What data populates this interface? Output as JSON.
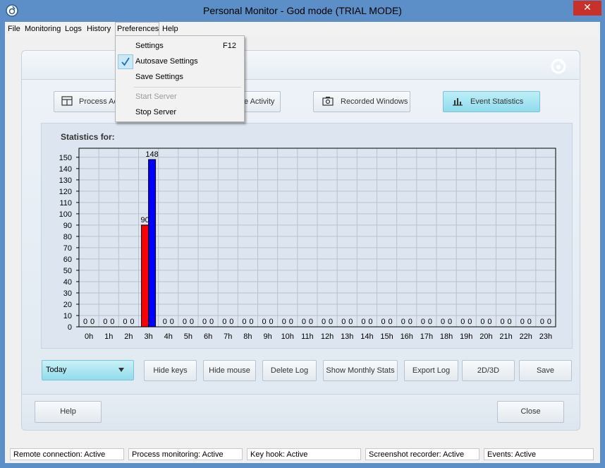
{
  "window": {
    "title": "Personal Monitor - God mode (TRIAL MODE)",
    "close_glyph": "✕"
  },
  "menu": [
    "File",
    "Monitoring",
    "Logs",
    "History",
    "Preferences",
    "Help"
  ],
  "preferences_menu": {
    "items": [
      {
        "label": "Settings",
        "shortcut": "F12",
        "checked": false,
        "disabled": false
      },
      {
        "label": "Autosave Settings",
        "shortcut": "",
        "checked": true,
        "disabled": false
      },
      {
        "label": "Save Settings",
        "shortcut": "",
        "checked": false,
        "disabled": false
      },
      {
        "label": "Start Server",
        "shortcut": "",
        "checked": false,
        "disabled": true
      },
      {
        "label": "Stop Server",
        "shortcut": "",
        "checked": false,
        "disabled": false
      }
    ]
  },
  "tabs": [
    {
      "label": "Process Ac",
      "icon": "window-icon"
    },
    {
      "label": "e Activity",
      "icon": ""
    },
    {
      "label": "Recorded Windows",
      "icon": "camera-icon"
    },
    {
      "label": "Event Statistics",
      "icon": "bar-chart-icon"
    }
  ],
  "stats_label": "Statistics for:",
  "chart_data": {
    "type": "bar",
    "categories": [
      "0h",
      "1h",
      "2h",
      "3h",
      "4h",
      "5h",
      "6h",
      "7h",
      "8h",
      "9h",
      "10h",
      "11h",
      "12h",
      "13h",
      "14h",
      "15h",
      "16h",
      "17h",
      "18h",
      "19h",
      "20h",
      "21h",
      "22h",
      "23h"
    ],
    "series": [
      {
        "values": [
          0,
          0,
          0,
          90,
          0,
          0,
          0,
          0,
          0,
          0,
          0,
          0,
          0,
          0,
          0,
          0,
          0,
          0,
          0,
          0,
          0,
          0,
          0,
          0
        ],
        "color": "#ff0000"
      },
      {
        "values": [
          0,
          0,
          0,
          148,
          0,
          0,
          0,
          0,
          0,
          0,
          0,
          0,
          0,
          0,
          0,
          0,
          0,
          0,
          0,
          0,
          0,
          0,
          0,
          0
        ],
        "color": "#0000ff"
      }
    ],
    "yticks": [
      0,
      10,
      20,
      30,
      40,
      50,
      60,
      70,
      80,
      90,
      100,
      110,
      120,
      130,
      140,
      150
    ],
    "ylim": [
      0,
      158
    ],
    "grid": true,
    "legend": "none"
  },
  "period_select": {
    "value": "Today"
  },
  "action_buttons": [
    "Hide keys",
    "Hide mouse",
    "Delete Log",
    "Show Monthly Stats",
    "Export Log",
    "2D/3D",
    "Save"
  ],
  "footer": {
    "help_label": "Help",
    "close_label": "Close"
  },
  "status": [
    "Remote connection: Active",
    "Process monitoring: Active",
    "Key hook: Active",
    "Screenshot recorder: Active",
    "Events: Active"
  ]
}
